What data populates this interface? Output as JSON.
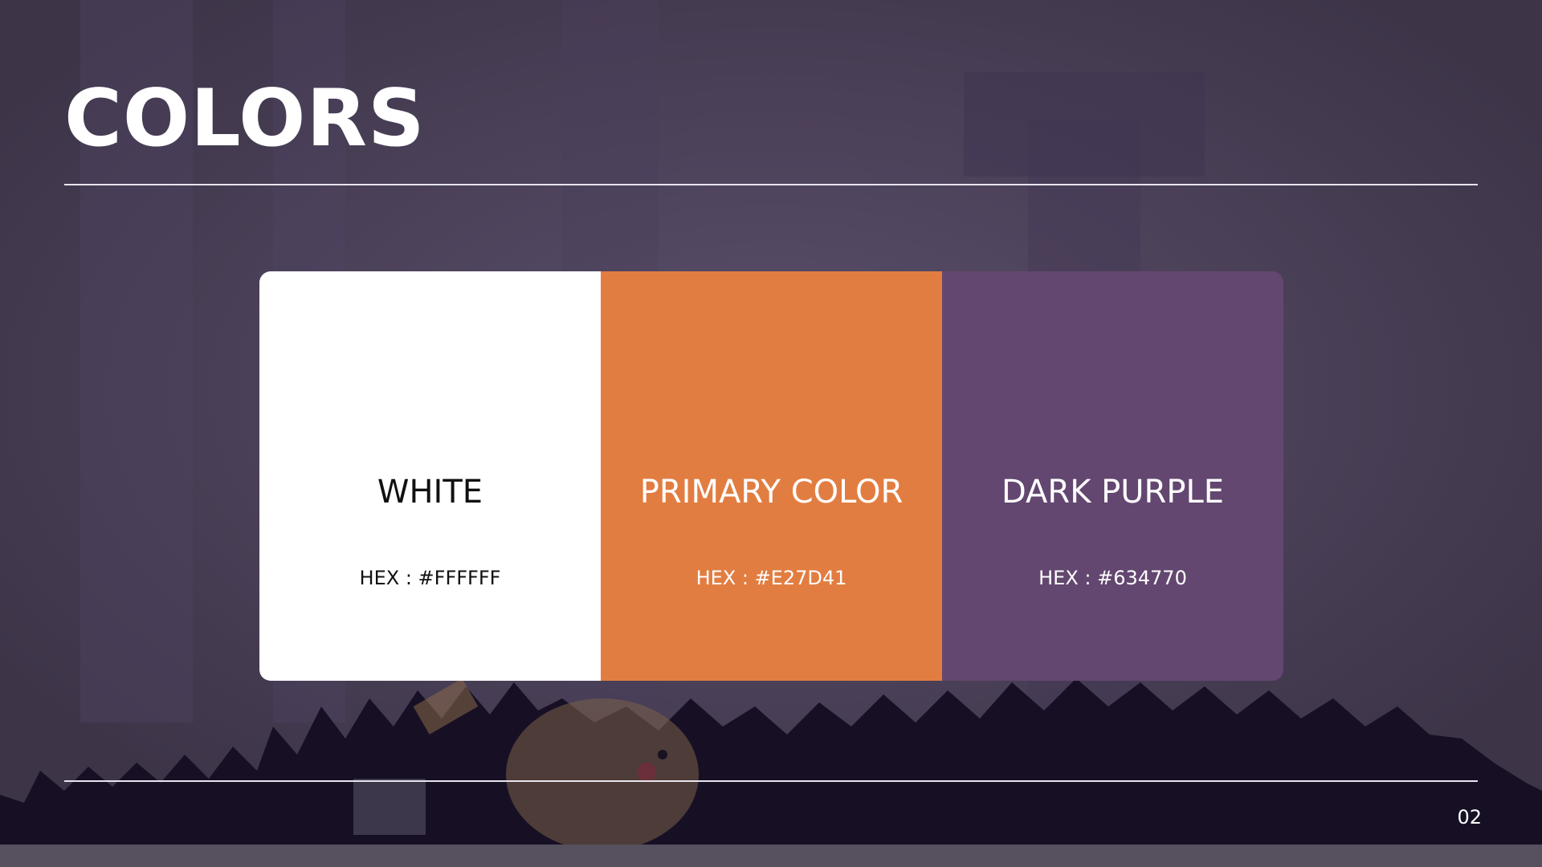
{
  "slide": {
    "title": "COLORS",
    "page_number": "02"
  },
  "swatches": [
    {
      "name": "WHITE",
      "hex_label": "HEX : #FFFFFF",
      "color": "#FFFFFF",
      "text_color": "#111111"
    },
    {
      "name": "PRIMARY COLOR",
      "hex_label": "HEX : #E27D41",
      "color": "#E27D41",
      "text_color": "#FFFFFF"
    },
    {
      "name": "DARK PURPLE",
      "hex_label": "HEX : #634770",
      "color": "#634770",
      "text_color": "#FFFFFF"
    }
  ],
  "background": {
    "base_color": "#4a4258",
    "grass_color": "#171025",
    "character_color": "#7a6048"
  }
}
